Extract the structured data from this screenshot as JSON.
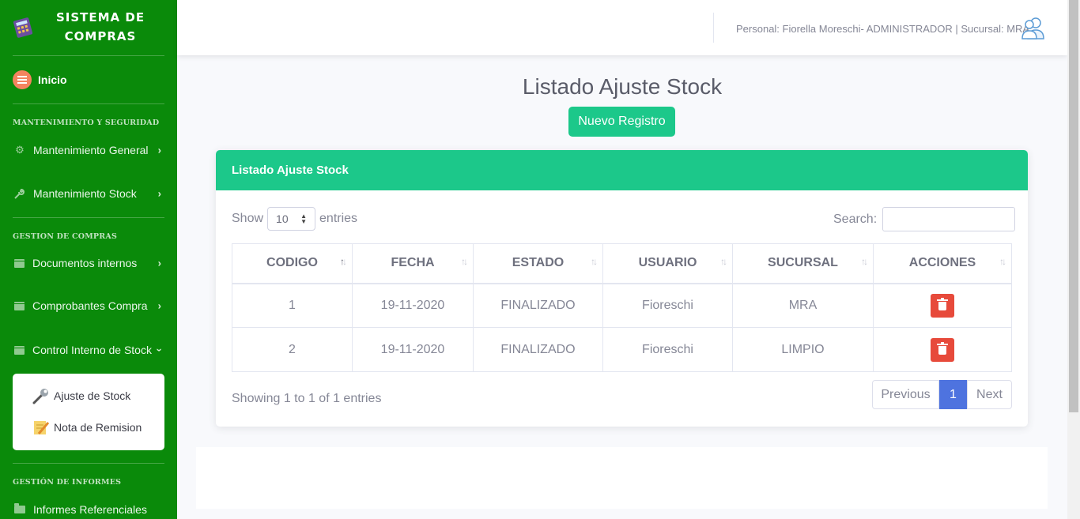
{
  "sidebar": {
    "brand": {
      "line1": "SISTEMA DE",
      "line2": "COMPRAS"
    },
    "home": "Inicio",
    "sections": [
      {
        "heading": "MANTENIMIENTO Y SEGURIDAD"
      },
      {
        "heading": "GESTION DE COMPRAS"
      },
      {
        "heading": "GESTIÓN DE INFORMES"
      }
    ],
    "items": [
      {
        "label": "Mantenimiento General",
        "icon": "gear-icon"
      },
      {
        "label": "Mantenimiento Stock",
        "icon": "wrench-icon"
      },
      {
        "label": "Documentos internos",
        "icon": "archive-icon"
      },
      {
        "label": "Comprobantes Compra",
        "icon": "archive-icon"
      },
      {
        "label": "Control Interno de Stock",
        "icon": "archive-icon"
      },
      {
        "label": "Informes Referenciales",
        "icon": "folder-icon"
      }
    ],
    "submenu": [
      {
        "label": "Ajuste de Stock",
        "icon": "wrench-icon"
      },
      {
        "label": "Nota de Remision",
        "icon": "note-pencil-icon"
      }
    ]
  },
  "topbar": {
    "user_info": "Personal: Fiorella Moreschi- ADMINISTRADOR | Sucursal: MRA"
  },
  "main": {
    "title": "Listado Ajuste Stock",
    "new_button": "Nuevo Registro",
    "card_title": "Listado Ajuste Stock",
    "show_label": "Show",
    "entries_label": "entries",
    "page_length": "10",
    "search_label": "Search:",
    "columns": [
      "CODIGO",
      "FECHA",
      "ESTADO",
      "USUARIO",
      "SUCURSAL",
      "ACCIONES"
    ],
    "rows": [
      {
        "codigo": "1",
        "fecha": "19-11-2020",
        "estado": "FINALIZADO",
        "usuario": "Fioreschi",
        "sucursal": "MRA"
      },
      {
        "codigo": "2",
        "fecha": "19-11-2020",
        "estado": "FINALIZADO",
        "usuario": "Fioreschi",
        "sucursal": "LIMPIO"
      }
    ],
    "info": "Showing 1 to 1 of 1 entries",
    "pagination": {
      "previous": "Previous",
      "current": "1",
      "next": "Next"
    }
  },
  "colors": {
    "sidebar": "#0a8a0a",
    "accent": "#1cc88a",
    "danger": "#e74a3b",
    "primary": "#4e73df"
  }
}
